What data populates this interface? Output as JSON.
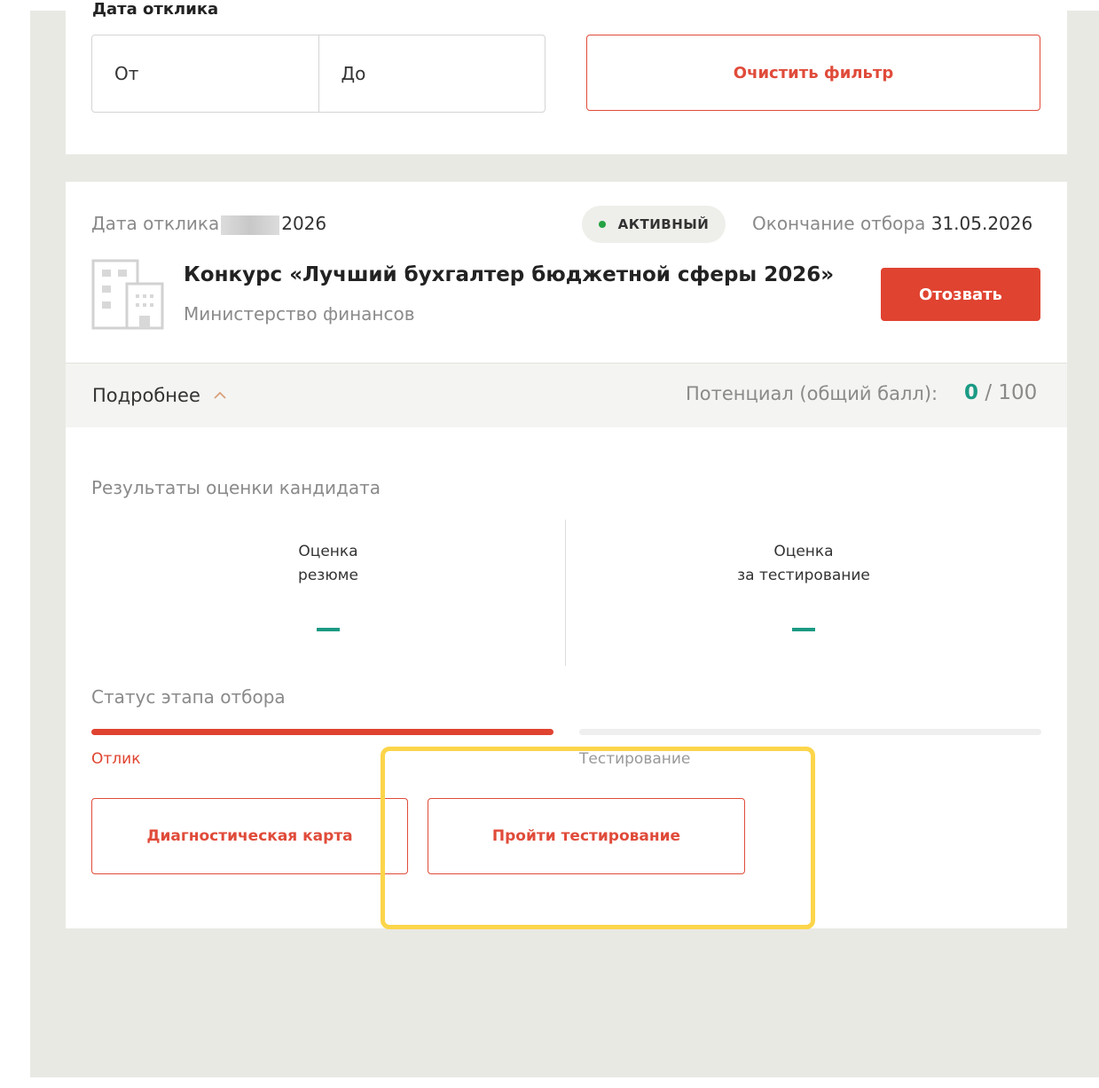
{
  "filter": {
    "title": "Дата отклика",
    "from_placeholder": "От",
    "to_placeholder": "До",
    "clear_label": "Очистить фильтр"
  },
  "application": {
    "response_date_label": "Дата отклика",
    "response_date_year": "2026",
    "status": "АКТИВНЫЙ",
    "end_label": "Окончание отбора",
    "end_date": "31.05.2026",
    "title": "Конкурс «Лучший бухгалтер бюджетной сферы 2026»",
    "organization": "Министерство финансов",
    "revoke_label": "Отозвать",
    "details_label": "Подробнее",
    "potential_label": "Потенциал (общий балл):",
    "score": "0",
    "score_max": "/ 100",
    "results_title": "Результаты оценки кандидата",
    "resume_score_line1": "Оценка",
    "resume_score_line2": "резюме",
    "test_score_line1": "Оценка",
    "test_score_line2": "за тестирование",
    "stage_status_title": "Статус этапа отбора",
    "stage_current": "Отлик",
    "stage_next": "Тестирование",
    "diag_card_label": "Диагностическая карта",
    "take_test_label": "Пройти тестирование"
  },
  "colors": {
    "accent": "#e04330",
    "score_green": "#1a9a84",
    "status_dot": "#25a244",
    "highlight": "#fcd54a"
  }
}
